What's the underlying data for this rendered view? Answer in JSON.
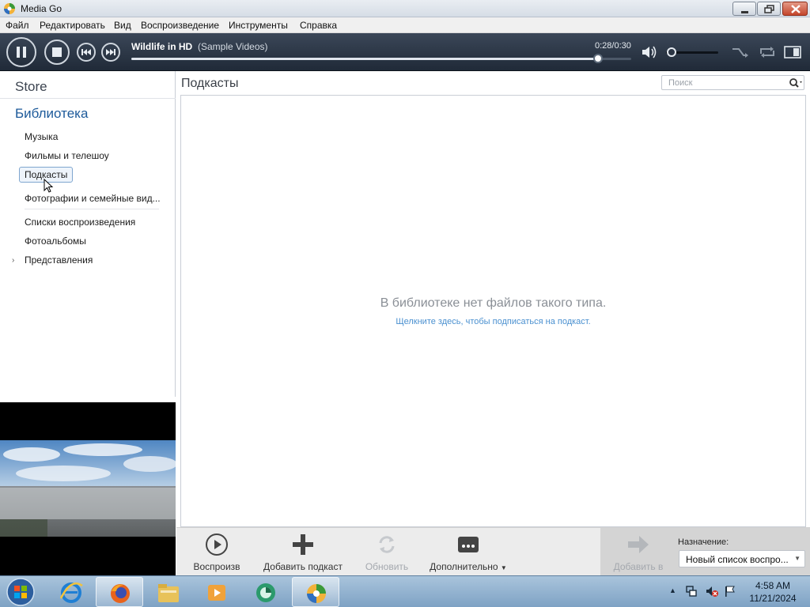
{
  "window": {
    "title": "Media Go"
  },
  "menu": [
    "Файл",
    "Редактировать",
    "Вид",
    "Воспроизведение",
    "Инструменты",
    "Справка"
  ],
  "player": {
    "track_title": "Wildlife in HD",
    "track_subtitle": "(Sample Videos)",
    "time": "0:28/0:30",
    "progress_fraction": 0.933,
    "volume_fraction": 0.1
  },
  "sidebar": {
    "store": "Store",
    "library": "Библиотека",
    "items": [
      {
        "label": "Музыка"
      },
      {
        "label": "Фильмы и телешоу"
      },
      {
        "label": "Подкасты",
        "selected": true
      },
      {
        "label": "Фотографии и семейные вид..."
      },
      {
        "label": "Списки воспроизведения"
      },
      {
        "label": "Фотоальбомы"
      },
      {
        "label": "Представления"
      }
    ]
  },
  "main": {
    "title": "Подкасты",
    "search_placeholder": "Поиск",
    "empty_message": "В библиотеке нет файлов такого типа.",
    "empty_link": "Щелкните здесь, чтобы подписаться на подкаст."
  },
  "toolbar": {
    "play": "Воспроизв",
    "add_podcast": "Добавить подкаст",
    "refresh": "Обновить",
    "more": "Дополнительно",
    "add_to": "Добавить в",
    "destination_label": "Назначение:",
    "destination_value": "Новый список воспро..."
  },
  "taskbar": {
    "time": "4:58 AM",
    "date": "11/21/2024"
  },
  "colors": {
    "player_bg": "#2b3544",
    "library_heading": "#1d5a9a",
    "link": "#4a90d0"
  }
}
